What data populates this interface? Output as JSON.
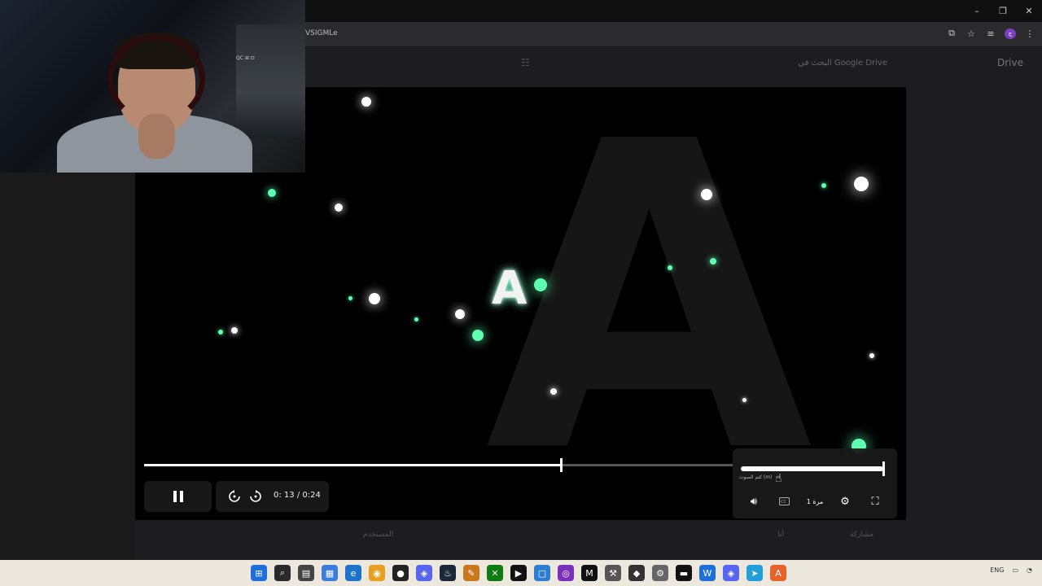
{
  "window": {
    "tab_title": "VSIGMLe",
    "minimize_label": "–",
    "restore_label": "❐",
    "close_label": "✕"
  },
  "browser": {
    "icon_install": "install-icon",
    "icon_star": "star-icon",
    "icon_media": "media-control-icon",
    "profile_initial": "ج",
    "menu_label": "⋮"
  },
  "drive": {
    "logo_text": "Drive",
    "search_placeholder": "البحث في Google Drive",
    "footer_owner": "أنا",
    "footer_label": "المستخدم",
    "footer_share": "مشاركة"
  },
  "webcam": {
    "shelf_label": "QC ⊞ ⊡"
  },
  "player": {
    "time_display": "0: 13 / 0:24",
    "progress_fraction": 0.7077,
    "volume_fraction": 1.0,
    "volume_tooltip": "كتم الصوت (m)",
    "speed_label": "1 مرة",
    "logo_letter": "A",
    "icons": {
      "pause": "pause-icon",
      "rewind": "rewind-10-icon",
      "forward": "forward-10-icon",
      "volume": "volume-icon",
      "captions": "captions-icon",
      "settings": "settings-icon",
      "fullscreen": "fullscreen-icon"
    },
    "accent_color": "#ffffff",
    "particle_color": "#5fffb0"
  },
  "taskbar": {
    "language": "ENG",
    "icons": [
      "windows-icon",
      "search-icon",
      "task-view-icon",
      "store-icon",
      "edge-icon",
      "chrome-icon",
      "obs-icon",
      "discord-icon",
      "steam-icon",
      "pencil-icon",
      "xbox-icon",
      "capcut-icon",
      "app-icon",
      "onenote-icon",
      "medium-icon",
      "tool-icon",
      "game-icon",
      "settings-icon",
      "terminal-icon",
      "wave-icon",
      "discord-icon-2",
      "telegram-icon",
      "app-icon-2"
    ]
  }
}
